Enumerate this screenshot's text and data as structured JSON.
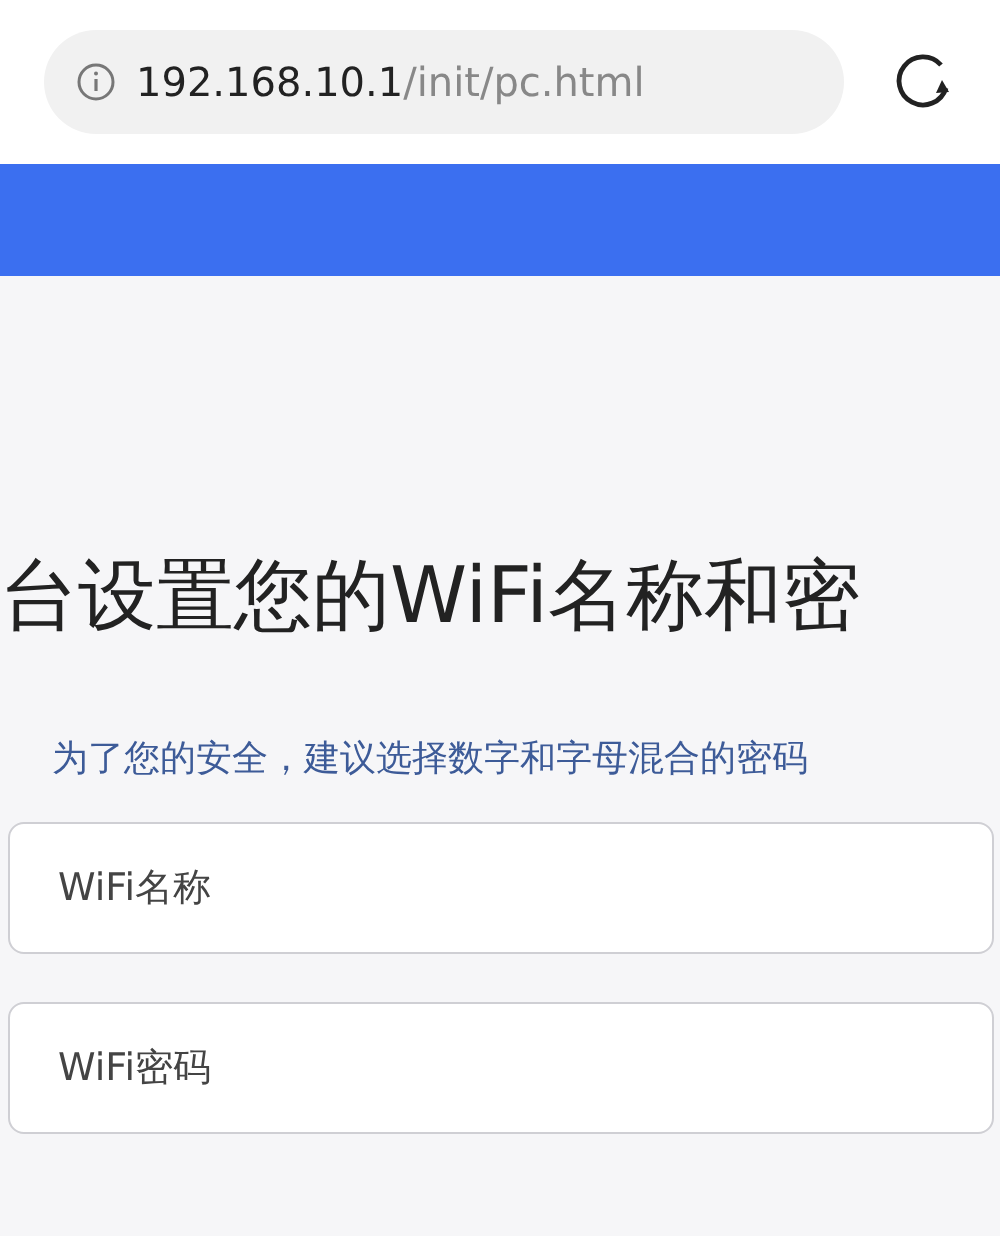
{
  "address_bar": {
    "host": "192.168.10.1",
    "path": "/init/pc.html"
  },
  "heading": "台设置您的WiFi名称和密",
  "hint": "为了您的安全，建议选择数字和字母混合的密码",
  "fields": [
    {
      "placeholder": "WiFi名称"
    },
    {
      "placeholder": "WiFi密码"
    }
  ]
}
